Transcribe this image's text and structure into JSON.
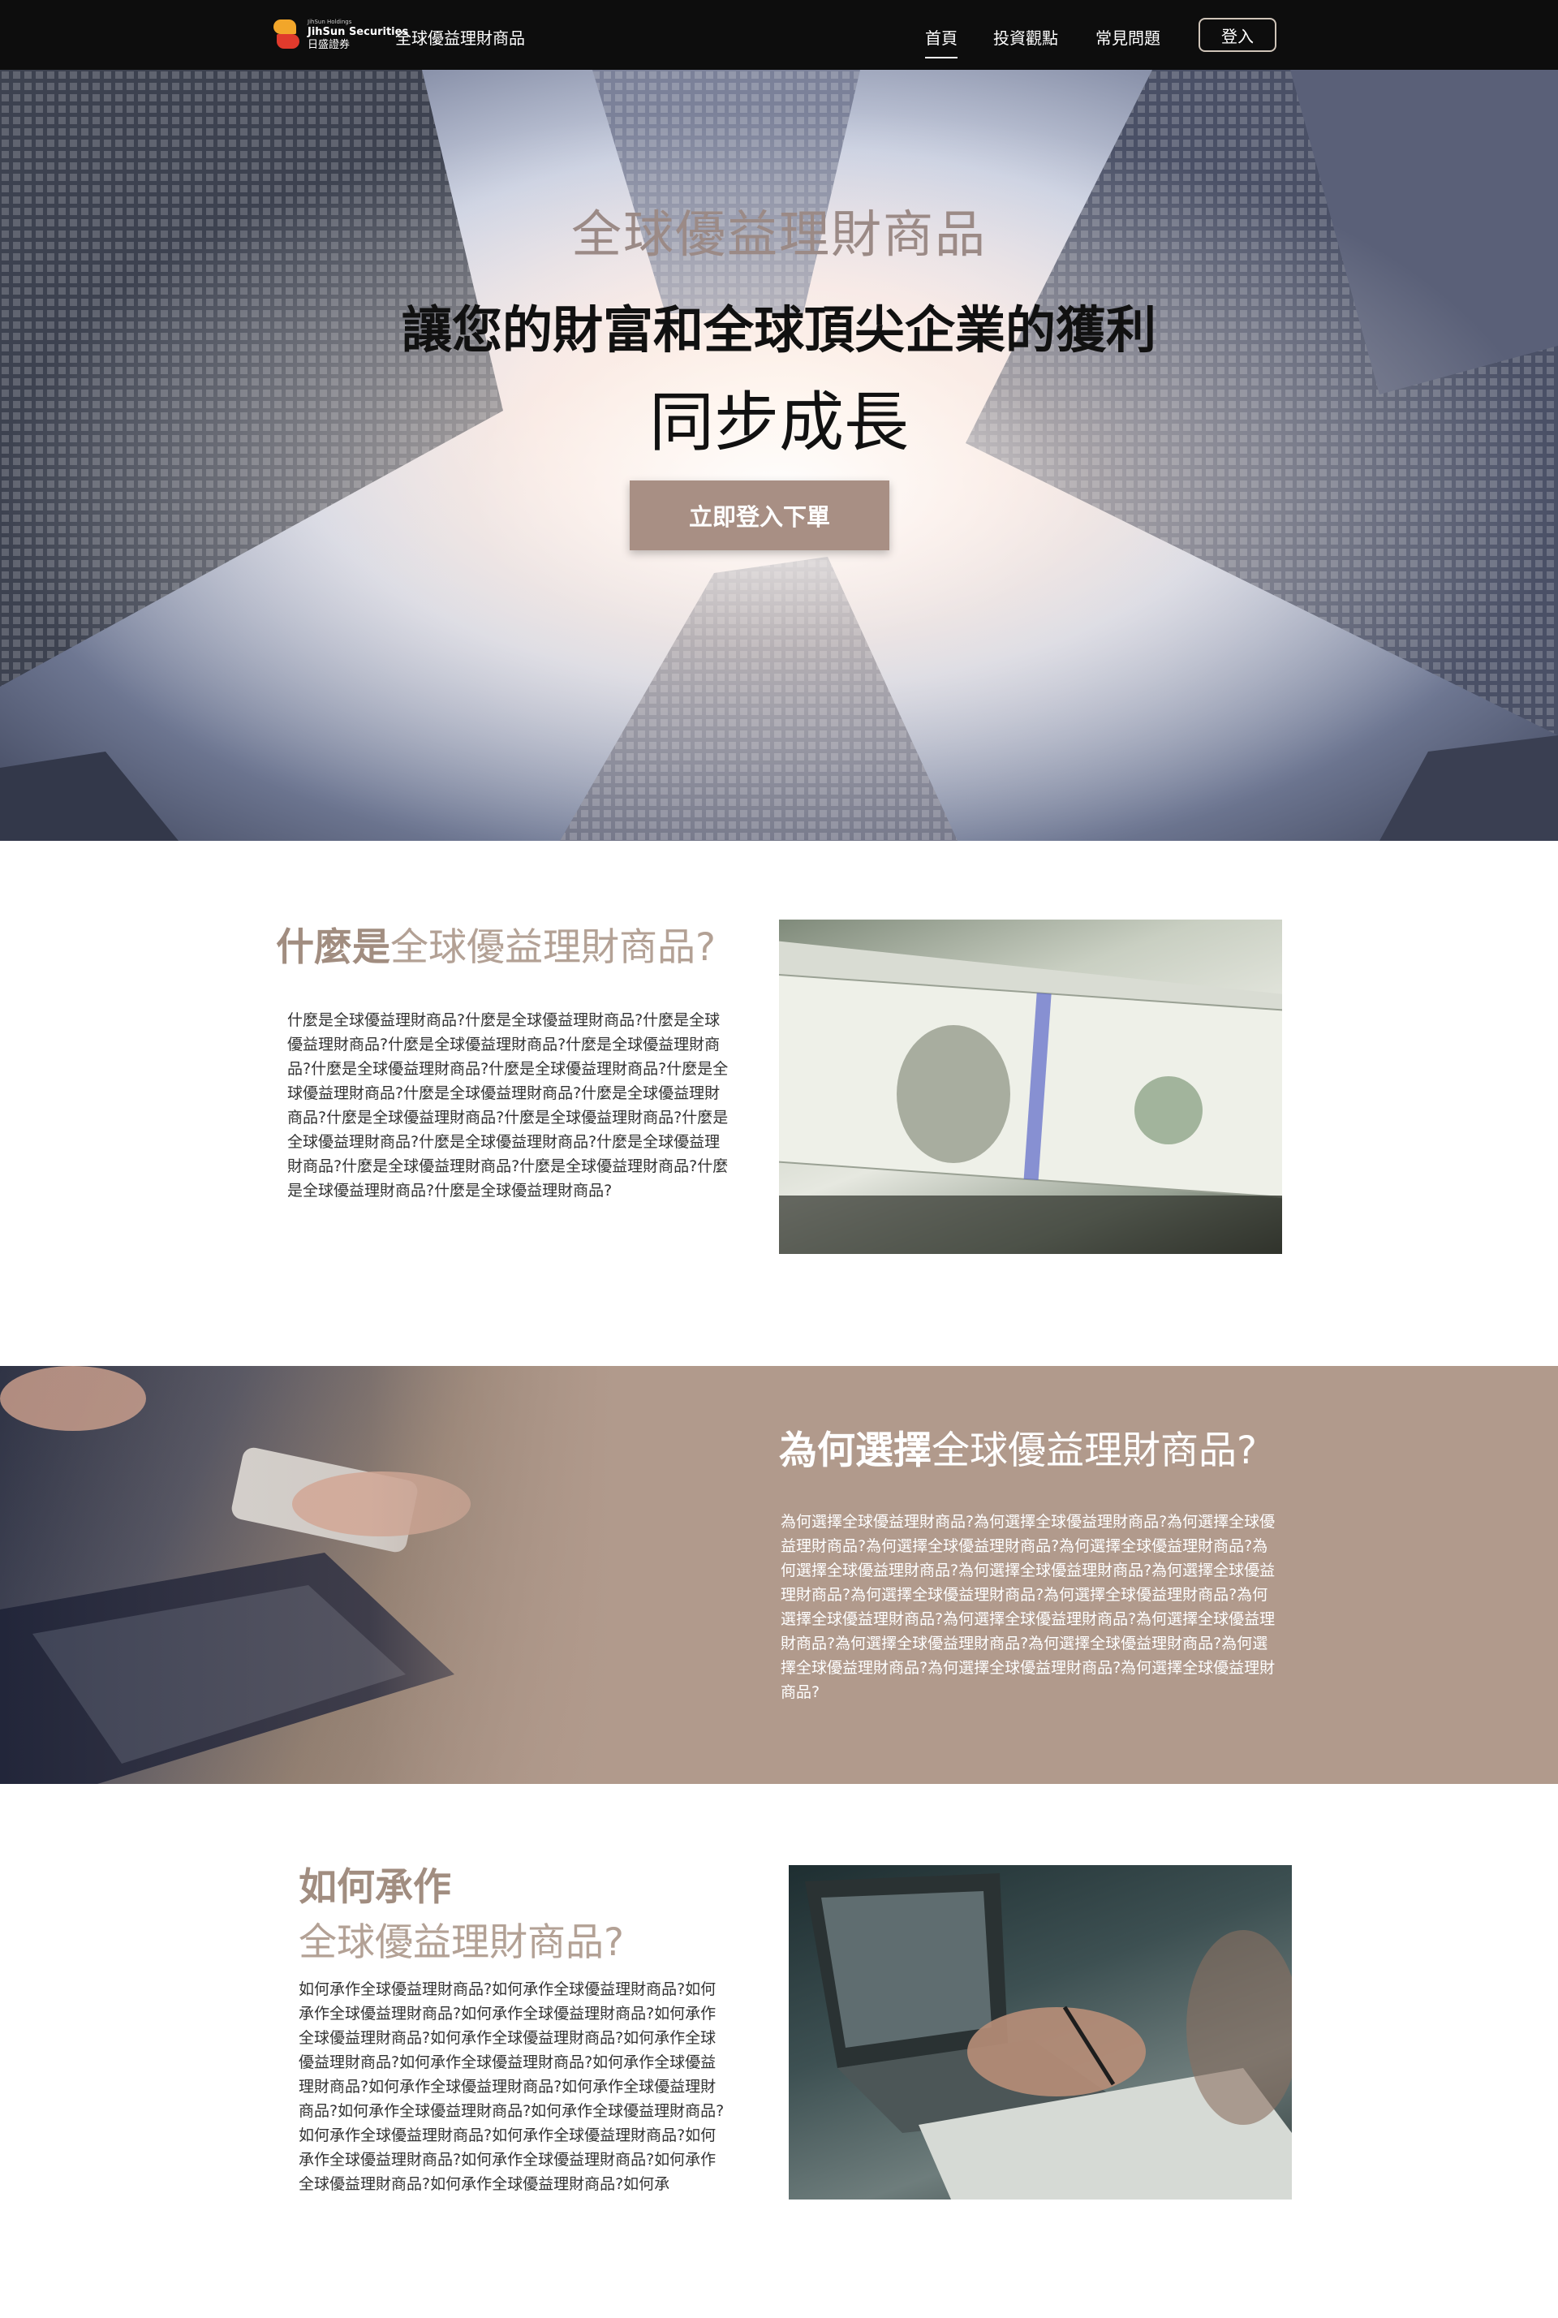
{
  "nav": {
    "logo": {
      "small": "JihSun Holdings",
      "en": "JihSun Securities",
      "zh": "日盛證券"
    },
    "site_name": "全球優益理財商品",
    "links": [
      "首頁",
      "投資觀點",
      "常見問題"
    ],
    "login": "登入"
  },
  "hero": {
    "subtitle": "全球優益理財商品",
    "title": "讓您的財富和全球頂尖企業的獲利",
    "title2": "同步成長",
    "cta": "立即登入下單"
  },
  "what": {
    "title_bold": "什麼是",
    "title_rest": "全球優益理財商品?",
    "body": "什麼是全球優益理財商品?什麼是全球優益理財商品?什麼是全球優益理財商品?什麼是全球優益理財商品?什麼是全球優益理財商品?什麼是全球優益理財商品?什麼是全球優益理財商品?什麼是全球優益理財商品?什麼是全球優益理財商品?什麼是全球優益理財商品?什麼是全球優益理財商品?什麼是全球優益理財商品?什麼是全球優益理財商品?什麼是全球優益理財商品?什麼是全球優益理財商品?什麼是全球優益理財商品?什麼是全球優益理財商品?什麼是全球優益理財商品?什麼是全球優益理財商品?"
  },
  "why": {
    "title_bold": "為何選擇",
    "title_rest": "全球優益理財商品?",
    "body": "為何選擇全球優益理財商品?為何選擇全球優益理財商品?為何選擇全球優益理財商品?為何選擇全球優益理財商品?為何選擇全球優益理財商品?為何選擇全球優益理財商品?為何選擇全球優益理財商品?為何選擇全球優益理財商品?為何選擇全球優益理財商品?為何選擇全球優益理財商品?為何選擇全球優益理財商品?為何選擇全球優益理財商品?為何選擇全球優益理財商品?為何選擇全球優益理財商品?為何選擇全球優益理財商品?為何選擇全球優益理財商品?為何選擇全球優益理財商品?為何選擇全球優益理財商品?"
  },
  "how": {
    "title_bold": "如何承作",
    "title_rest": "全球優益理財商品?",
    "body": "如何承作全球優益理財商品?如何承作全球優益理財商品?如何承作全球優益理財商品?如何承作全球優益理財商品?如何承作全球優益理財商品?如何承作全球優益理財商品?如何承作全球優益理財商品?如何承作全球優益理財商品?如何承作全球優益理財商品?如何承作全球優益理財商品?如何承作全球優益理財商品?如何承作全球優益理財商品?如何承作全球優益理財商品?如何承作全球優益理財商品?如何承作全球優益理財商品?如何承作全球優益理財商品?如何承作全球優益理財商品?如何承作全球優益理財商品?如何承作全球優益理財商品?如何承"
  }
}
